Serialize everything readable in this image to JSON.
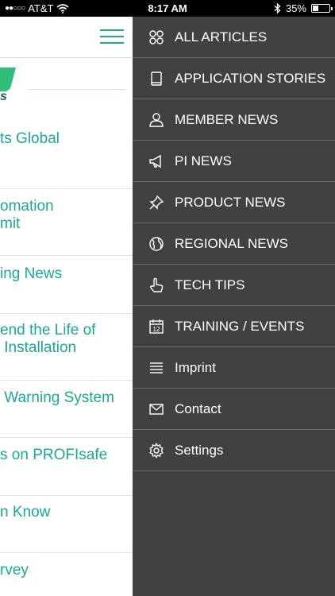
{
  "status_bar": {
    "carrier": "AT&T",
    "signal": "●●○○○",
    "time": "8:17 AM",
    "battery_percent_text": "35%",
    "battery_level": 0.35
  },
  "articles": [
    {
      "line1": "ts Global",
      "line2": ""
    },
    {
      "line1": "omation",
      "line2": "mit"
    },
    {
      "line1": "ing News",
      "line2": ""
    },
    {
      "line1": "end the Life of",
      "line2": " Installation"
    },
    {
      "line1": " Warning System",
      "line2": ""
    },
    {
      "line1": "s on PROFIsafe",
      "line2": ""
    },
    {
      "line1": "n Know",
      "line2": ""
    },
    {
      "line1": "rvey",
      "line2": ""
    }
  ],
  "menu": {
    "items": [
      {
        "label": "ALL ARTICLES",
        "icon": "grid-icon"
      },
      {
        "label": "APPLICATION STORIES",
        "icon": "book-icon"
      },
      {
        "label": "MEMBER NEWS",
        "icon": "user-icon"
      },
      {
        "label": "PI NEWS",
        "icon": "megaphone-icon"
      },
      {
        "label": "PRODUCT NEWS",
        "icon": "pushpin-icon"
      },
      {
        "label": "REGIONAL NEWS",
        "icon": "globe-icon"
      },
      {
        "label": "TECH TIPS",
        "icon": "hand-icon"
      },
      {
        "label": "TRAINING / EVENTS",
        "icon": "calendar-icon",
        "icon_text": "12"
      },
      {
        "label": "Imprint",
        "icon": "text-lines-icon"
      },
      {
        "label": "Contact",
        "icon": "envelope-icon"
      },
      {
        "label": "Settings",
        "icon": "gear-icon"
      }
    ]
  },
  "colors": {
    "accent": "#1aaa92",
    "drawer_bg": "#414141",
    "divider": "#6a6a6a",
    "logo_green": "#2fbf7a"
  }
}
